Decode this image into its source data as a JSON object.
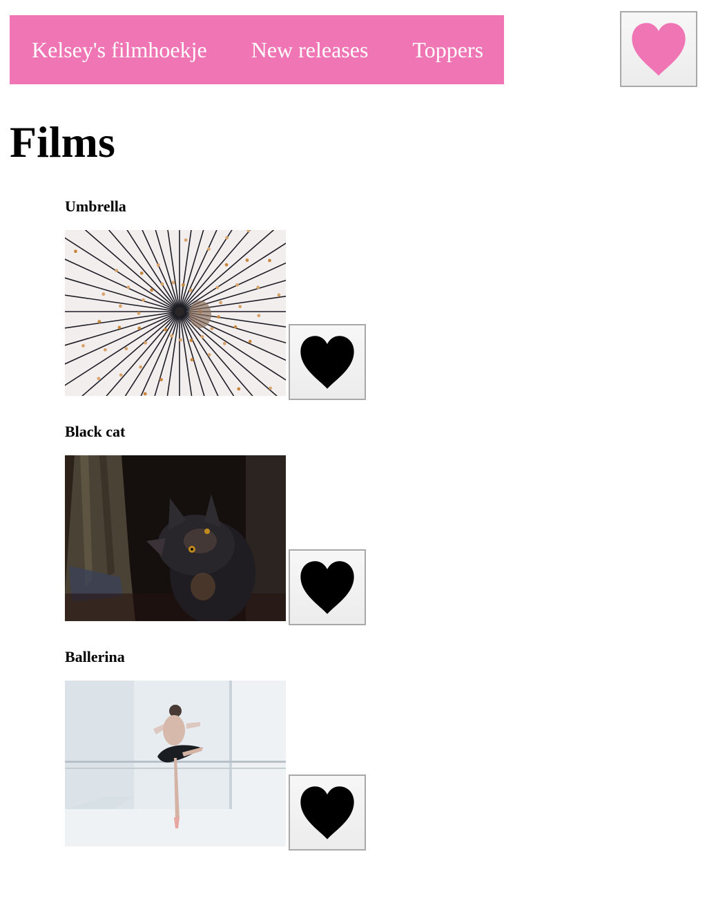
{
  "nav": {
    "items": [
      {
        "label": "Kelsey's filmhoekje"
      },
      {
        "label": "New releases"
      },
      {
        "label": "Toppers"
      }
    ],
    "favorites_icon": "heart-icon",
    "color": "#f075b5"
  },
  "main": {
    "title": "Films",
    "films": [
      {
        "title": "Umbrella",
        "image": "umbrella-photo",
        "favorite_icon": "heart-icon"
      },
      {
        "title": "Black cat",
        "image": "black-cat-photo",
        "favorite_icon": "heart-icon"
      },
      {
        "title": "Ballerina",
        "image": "ballerina-photo",
        "favorite_icon": "heart-icon"
      }
    ]
  },
  "colors": {
    "accent": "#f075b5",
    "heart_default": "#000000",
    "button_border": "#a8a8a8"
  }
}
